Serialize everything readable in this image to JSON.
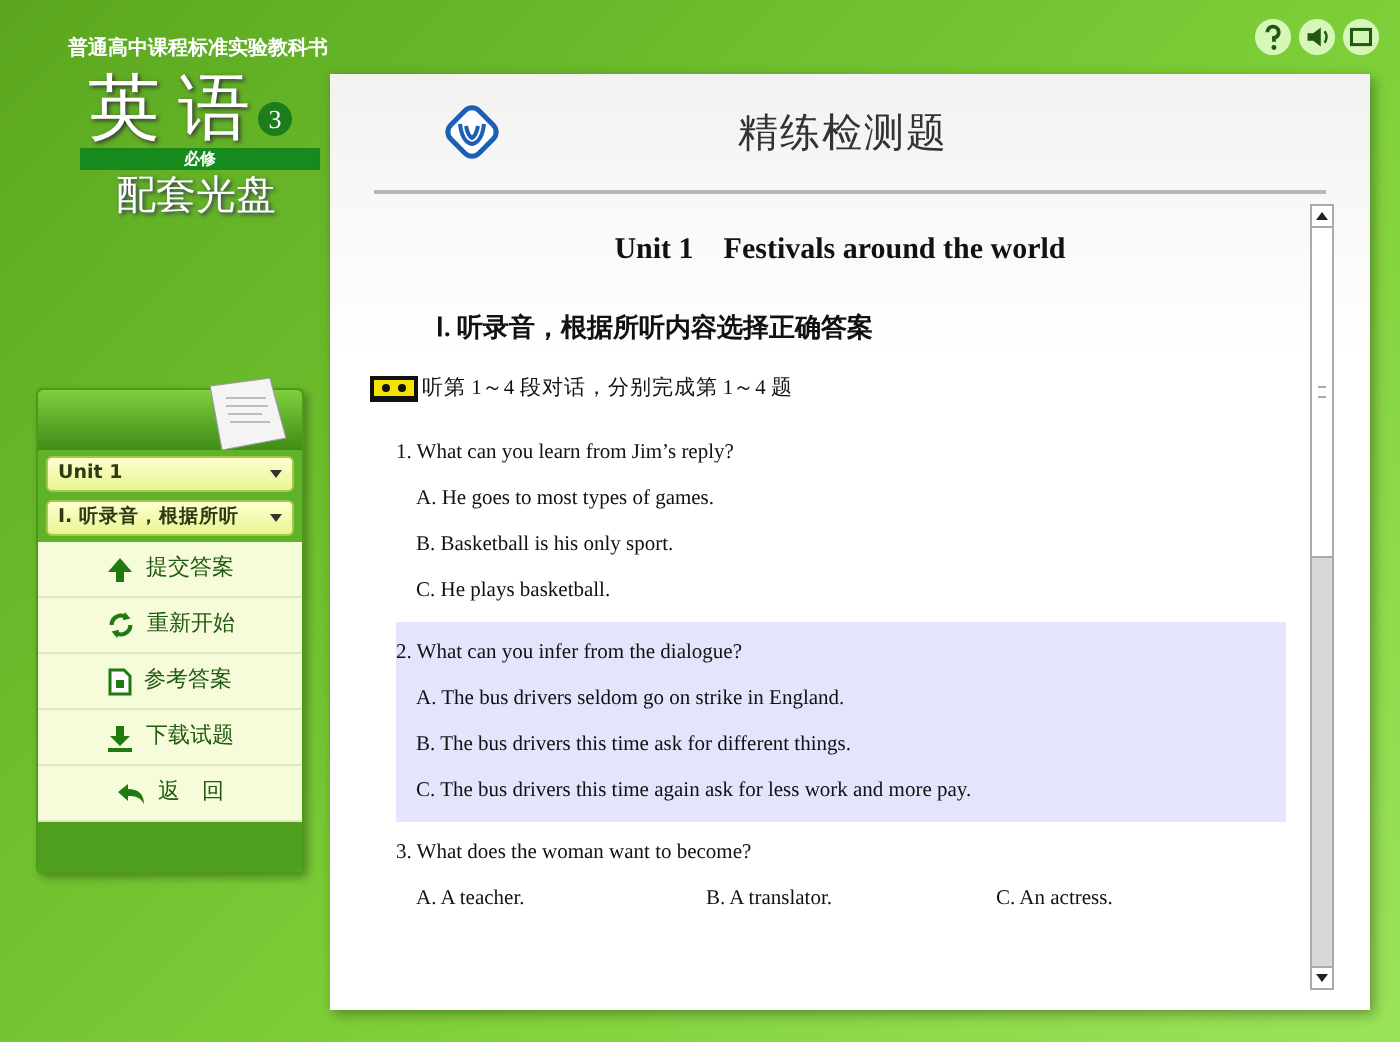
{
  "brand": {
    "series": "普通高中课程标准实验教科书",
    "title": "英 语",
    "volume": "3",
    "band": "必修",
    "subtitle": "配套光盘"
  },
  "sidebar": {
    "dropdowns": [
      {
        "value": "Unit 1"
      },
      {
        "value": "Ⅰ. 听录音，根据所听"
      }
    ],
    "items": [
      {
        "label": "提交答案",
        "kind": "submit"
      },
      {
        "label": "重新开始",
        "kind": "restart"
      },
      {
        "label": "参考答案",
        "kind": "answers"
      },
      {
        "label": "下载试题",
        "kind": "download"
      },
      {
        "label": "返　回",
        "kind": "back"
      }
    ]
  },
  "panel": {
    "title": "精练检测题",
    "unit_title": "Unit 1　Festivals around the world",
    "section": "Ⅰ. 听录音，根据所听内容选择正确答案",
    "instruction": "听第 1～4 段对话，分别完成第 1～4 题",
    "questions": [
      {
        "text": "1. What can you learn from Jim’s reply?",
        "kind": "stacked",
        "selected": false,
        "options": [
          "A. He goes to most types of games.",
          "B. Basketball is his only sport.",
          "C. He plays basketball."
        ]
      },
      {
        "text": "2. What can you infer from the dialogue?",
        "kind": "stacked",
        "selected": true,
        "options": [
          "A. The bus drivers seldom go on strike in England.",
          "B. The bus drivers this time ask for different things.",
          "C. The bus drivers this time again ask for less work and more pay."
        ]
      },
      {
        "text": "3. What does the woman want to become?",
        "kind": "inline",
        "selected": false,
        "options": [
          "A. A teacher.",
          "B. A translator.",
          "C. An actress."
        ]
      }
    ]
  }
}
